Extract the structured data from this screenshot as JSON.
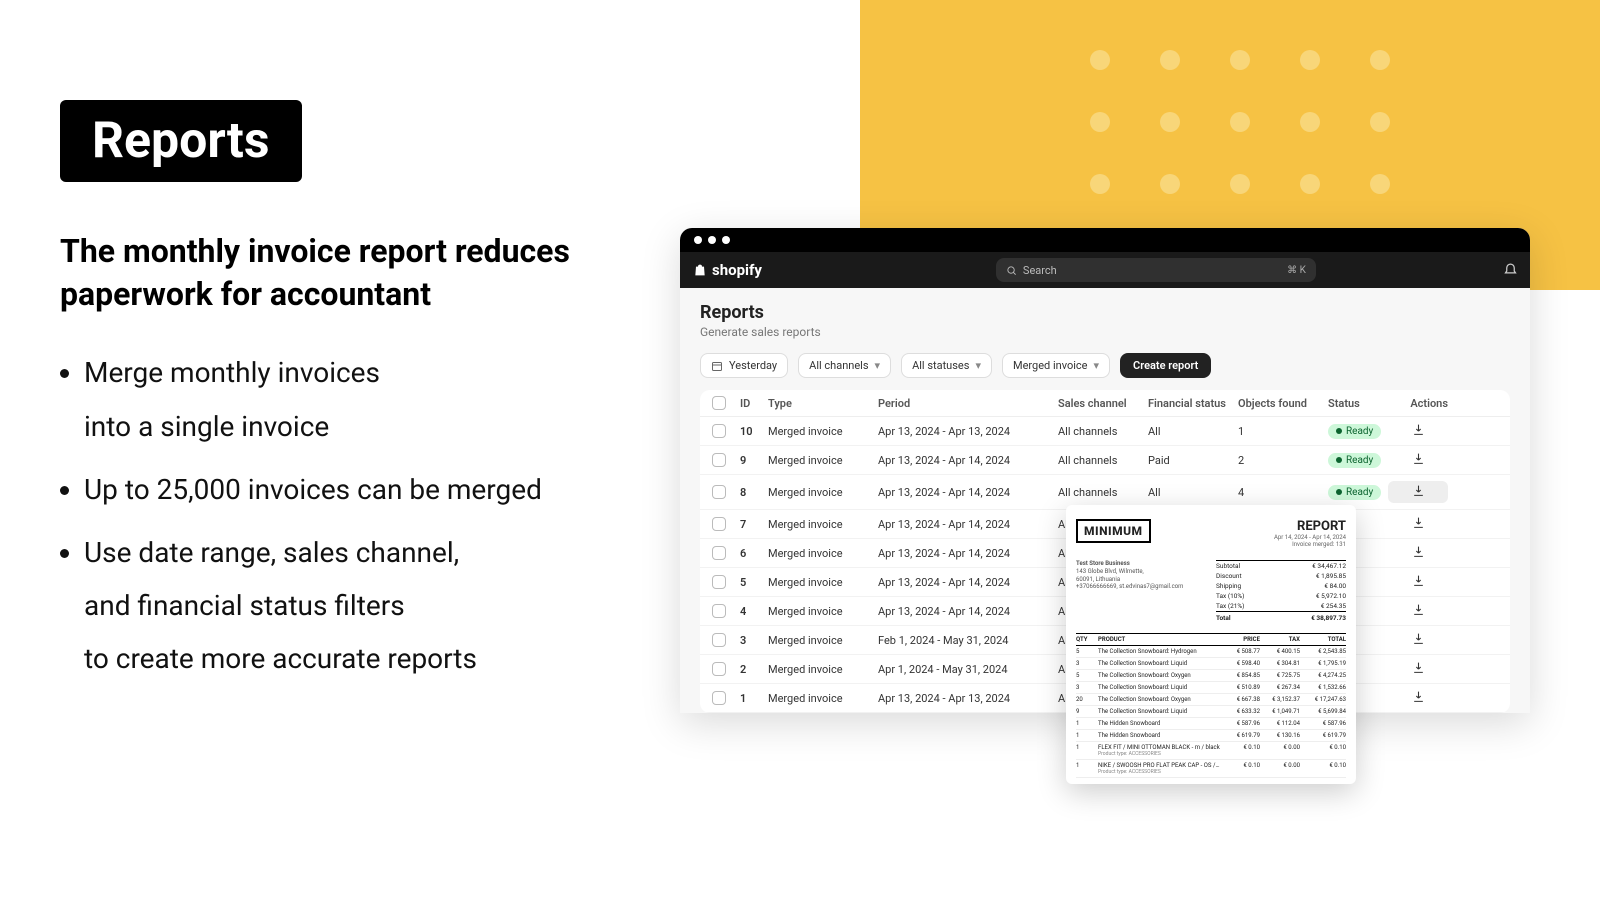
{
  "marketing": {
    "badge": "Reports",
    "headline": "The monthly invoice report reduces paperwork for accountant",
    "bullets": [
      [
        "Merge monthly invoices",
        "into a single invoice"
      ],
      [
        "Up to 25,000 invoices can be merged"
      ],
      [
        "Use date range, sales channel,",
        "and financial status filters",
        "to create more accurate reports"
      ]
    ]
  },
  "app": {
    "brand": "shopify",
    "search_placeholder": "Search",
    "search_shortcut": "⌘ K",
    "page_title": "Reports",
    "page_sub": "Generate sales reports",
    "filters": {
      "date": "Yesterday",
      "channel": "All channels",
      "status": "All statuses",
      "type": "Merged invoice"
    },
    "create_btn": "Create report",
    "columns": [
      "",
      "ID",
      "Type",
      "Period",
      "Sales channel",
      "Financial status",
      "Objects found",
      "Status",
      "Actions"
    ],
    "rows": [
      {
        "id": "10",
        "type": "Merged invoice",
        "period": "Apr 13, 2024 - Apr 13, 2024",
        "channel": "All channels",
        "fin": "All",
        "found": "1",
        "status": "Ready"
      },
      {
        "id": "9",
        "type": "Merged invoice",
        "period": "Apr 13, 2024 - Apr 14, 2024",
        "channel": "All channels",
        "fin": "Paid",
        "found": "2",
        "status": "Ready"
      },
      {
        "id": "8",
        "type": "Merged invoice",
        "period": "Apr 13, 2024 - Apr 14, 2024",
        "channel": "All channels",
        "fin": "All",
        "found": "4",
        "status": "Ready"
      },
      {
        "id": "7",
        "type": "Merged invoice",
        "period": "Apr 13, 2024 - Apr 14, 2024",
        "channel": "All c",
        "fin": "",
        "found": "",
        "status": ""
      },
      {
        "id": "6",
        "type": "Merged invoice",
        "period": "Apr 13, 2024 - Apr 14, 2024",
        "channel": "All c",
        "fin": "",
        "found": "",
        "status": ""
      },
      {
        "id": "5",
        "type": "Merged invoice",
        "period": "Apr 13, 2024 - Apr 14, 2024",
        "channel": "All c",
        "fin": "",
        "found": "",
        "status": ""
      },
      {
        "id": "4",
        "type": "Merged invoice",
        "period": "Apr 13, 2024 - Apr 14, 2024",
        "channel": "All c",
        "fin": "",
        "found": "",
        "status": ""
      },
      {
        "id": "3",
        "type": "Merged invoice",
        "period": "Feb 1, 2024 - May 31, 2024",
        "channel": "All c",
        "fin": "",
        "found": "",
        "status": ""
      },
      {
        "id": "2",
        "type": "Merged invoice",
        "period": "Apr 1, 2024 - May 31, 2024",
        "channel": "All c",
        "fin": "",
        "found": "",
        "status": ""
      },
      {
        "id": "1",
        "type": "Merged invoice",
        "period": "Apr 13, 2024 - Apr 13, 2024",
        "channel": "All c",
        "fin": "",
        "found": "",
        "status": ""
      }
    ]
  },
  "invoice": {
    "logo": "MINIMUM",
    "title": "REPORT",
    "date_range": "Apr 14, 2024 - Apr 14, 2024",
    "merged": "Invoice merged: 131",
    "from": {
      "name": "Test Store Business",
      "addr1": "143 Globe Blvd, Wilmette,",
      "addr2": "60091, Lithuania",
      "contact": "+37066666669, st.edvinas7@gmail.com"
    },
    "totals": [
      {
        "label": "Subtotal",
        "val": "€ 34,467.12"
      },
      {
        "label": "Discount",
        "val": "€ 1,895.85"
      },
      {
        "label": "Shipping",
        "val": "€ 84.00"
      },
      {
        "label": "Tax (10%)",
        "val": "€ 5,972.10"
      },
      {
        "label": "Tax (21%)",
        "val": "€ 254.35"
      }
    ],
    "total_label": "Total",
    "total_val": "€ 38,897.73",
    "cols": {
      "qty": "QTY",
      "product": "PRODUCT",
      "price": "PRICE",
      "tax": "TAX",
      "total": "TOTAL"
    },
    "items": [
      {
        "qty": "5",
        "name": "The Collection Snowboard: Hydrogen",
        "price": "€ 508.77",
        "tax": "€ 400.15",
        "total": "€ 2,543.85"
      },
      {
        "qty": "3",
        "name": "The Collection Snowboard: Liquid",
        "price": "€ 598.40",
        "tax": "€ 304.81",
        "total": "€ 1,795.19"
      },
      {
        "qty": "5",
        "name": "The Collection Snowboard: Oxygen",
        "price": "€ 854.85",
        "tax": "€ 725.75",
        "total": "€ 4,274.25"
      },
      {
        "qty": "3",
        "name": "The Collection Snowboard: Liquid",
        "price": "€ 510.89",
        "tax": "€ 267.34",
        "total": "€ 1,532.66"
      },
      {
        "qty": "20",
        "name": "The Collection Snowboard: Oxygen",
        "price": "€ 667.38",
        "tax": "€ 3,152.37",
        "total": "€ 17,247.63"
      },
      {
        "qty": "9",
        "name": "The Collection Snowboard: Liquid",
        "price": "€ 633.32",
        "tax": "€ 1,049.71",
        "total": "€ 5,699.84"
      },
      {
        "qty": "1",
        "name": "The Hidden Snowboard",
        "price": "€ 587.96",
        "tax": "€ 112.04",
        "total": "€ 587.96"
      },
      {
        "qty": "1",
        "name": "The Hidden Snowboard",
        "price": "€ 619.79",
        "tax": "€ 130.16",
        "total": "€ 619.79"
      },
      {
        "qty": "1",
        "name": "FLEX FIT / MINI OTTOMAN BLACK - m / black",
        "sub": "Product type: ACCESSORIES",
        "price": "€ 0.10",
        "tax": "€ 0.00",
        "total": "€ 0.10"
      },
      {
        "qty": "1",
        "name": "NIKE / SWOOSH PRO FLAT PEAK CAP - OS / white",
        "sub": "Product type: ACCESSORIES",
        "price": "€ 0.10",
        "tax": "€ 0.00",
        "total": "€ 0.10"
      }
    ]
  }
}
